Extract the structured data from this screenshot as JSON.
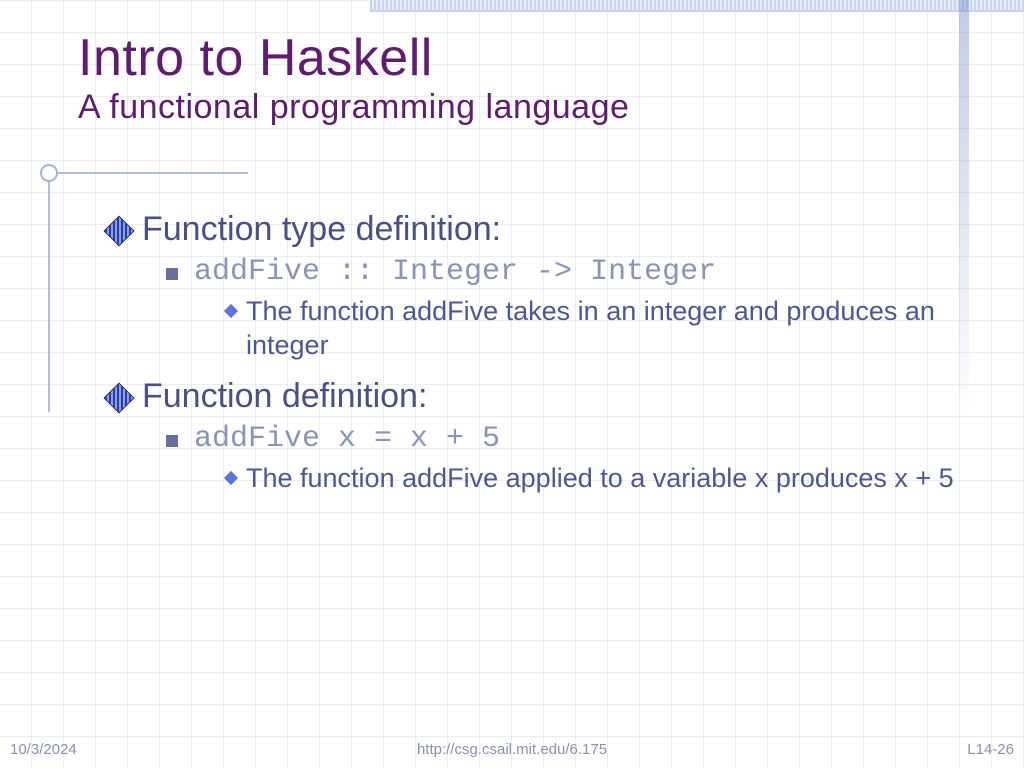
{
  "header": {
    "title": "Intro to Haskell",
    "subtitle": "A functional programming language"
  },
  "bullets": {
    "type_def_label": "Function type definition:",
    "type_def_code": "addFive :: Integer -> Integer",
    "type_def_explain": "The function addFive takes in an integer and produces an integer",
    "fn_def_label": "Function definition:",
    "fn_def_code": "addFive x = x + 5",
    "fn_def_explain": "The function addFive applied to a variable x produces x + 5"
  },
  "footer": {
    "date": "10/3/2024",
    "url": "http://csg.csail.mit.edu/6.175",
    "page": "L14-26"
  }
}
